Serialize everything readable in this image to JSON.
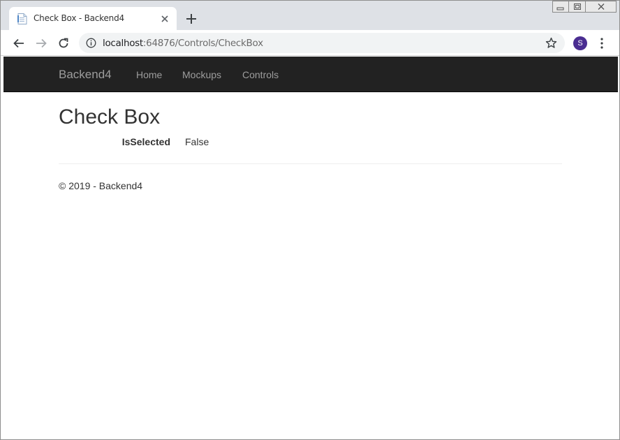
{
  "browser": {
    "tab": {
      "title": "Check Box - Backend4",
      "favicon": "page-icon"
    },
    "address": {
      "host": "localhost",
      "rest": ":64876/Controls/CheckBox"
    },
    "profile_initial": "S",
    "profile_color": "#4a2d91"
  },
  "site": {
    "brand": "Backend4",
    "nav": [
      "Home",
      "Mockups",
      "Controls"
    ],
    "navbar_color": "#222222"
  },
  "main": {
    "title": "Check Box",
    "fields": [
      {
        "label": "IsSelected",
        "value": "False"
      }
    ]
  },
  "footer": {
    "text": "© 2019 - Backend4"
  }
}
